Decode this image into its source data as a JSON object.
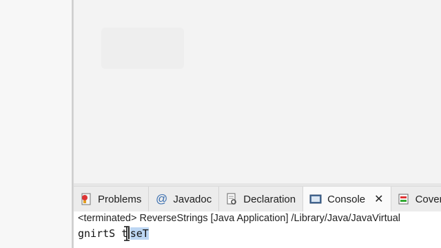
{
  "tabs": [
    {
      "label": "Problems",
      "icon": "problems-icon"
    },
    {
      "label": "Javadoc",
      "icon": "at-sign-icon"
    },
    {
      "label": "Declaration",
      "icon": "declaration-icon"
    },
    {
      "label": "Console",
      "icon": "console-icon",
      "active": true
    },
    {
      "label": "Cover",
      "icon": "coverage-icon"
    }
  ],
  "console": {
    "status": "<terminated> ReverseStrings [Java Application] /Library/Java/JavaVirtual",
    "output_before": "gnirtS ",
    "output_mid": "t",
    "output_selected": "seT"
  },
  "colors": {
    "selection": "#bcd6f3"
  }
}
